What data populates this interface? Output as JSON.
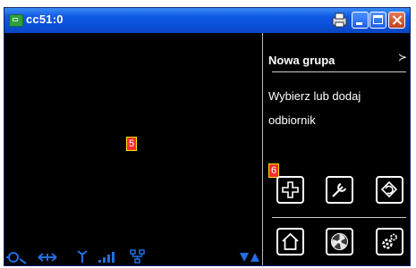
{
  "window": {
    "title": "cc51:0",
    "app_icon": "monitor-icon",
    "controls": [
      "print-icon",
      "minimize-icon",
      "maximize-icon",
      "close-icon"
    ]
  },
  "viewport": {
    "marker": "5"
  },
  "panel": {
    "title": "Nowa grupa",
    "close_icon": "chevron-right-icon",
    "message": "Wybierz lub dodaj odbiornik",
    "marker": "6",
    "top_buttons": [
      "add-icon",
      "wrench-icon",
      "back-icon"
    ],
    "bottom_buttons": [
      "home-icon",
      "fan-icon",
      "settings-icon"
    ]
  },
  "status_bar": {
    "icons": [
      "connection-icon",
      "transfer-icon",
      "antenna-icon",
      "signal-bars-icon",
      "network-icon",
      "scroll-arrows-icon"
    ]
  },
  "colors": {
    "titlebar": "#0f59e4",
    "background": "#000000",
    "marker": "#ff2d2d",
    "status_icons": "#1f6fe0"
  }
}
